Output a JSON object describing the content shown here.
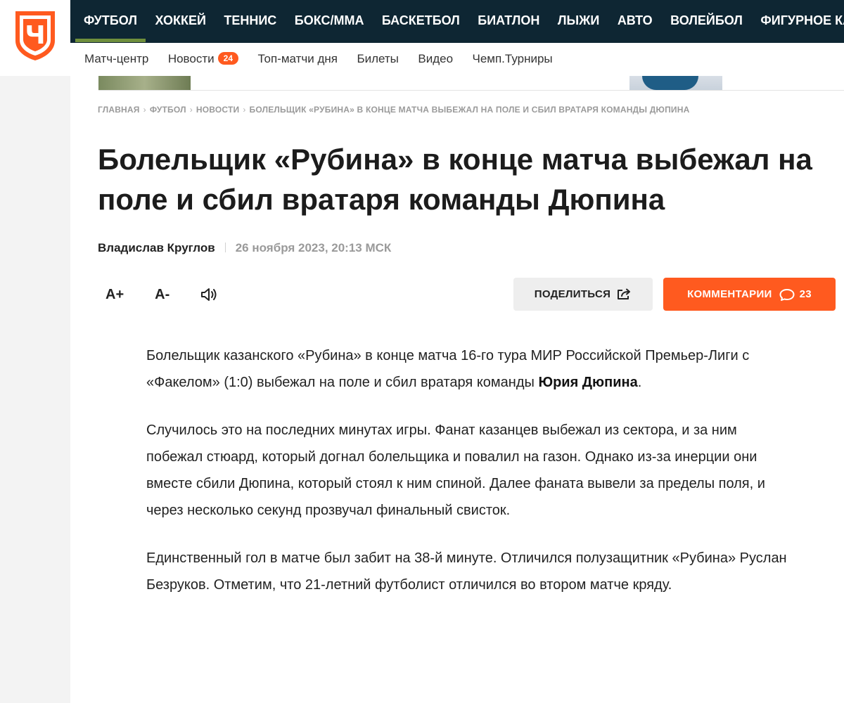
{
  "logo": {
    "letter": "Ч",
    "color": "#ff5a1f"
  },
  "topnav": {
    "items": [
      "ФУТБОЛ",
      "ХОККЕЙ",
      "ТЕННИС",
      "БОКС/ММА",
      "БАСКЕТБОЛ",
      "БИАТЛОН",
      "ЛЫЖИ",
      "АВТО",
      "ВОЛЕЙБОЛ",
      "ФИГУРНОЕ КАТАНИЕ"
    ],
    "active_index": 0,
    "bg_color": "#0e2633",
    "active_underline_color": "#6f8f3c"
  },
  "subnav": {
    "items": [
      {
        "label": "Матч-центр"
      },
      {
        "label": "Новости",
        "badge": "24"
      },
      {
        "label": "Топ-матчи дня"
      },
      {
        "label": "Билеты"
      },
      {
        "label": "Видео"
      },
      {
        "label": "Чемп.Турниры"
      }
    ]
  },
  "breadcrumb": [
    "ГЛАВНАЯ",
    "ФУТБОЛ",
    "НОВОСТИ",
    "БОЛЕЛЬЩИК «РУБИНА» В КОНЦЕ МАТЧА ВЫБЕЖАЛ НА ПОЛЕ И СБИЛ ВРАТАРЯ КОМАНДЫ ДЮПИНА"
  ],
  "article": {
    "title": "Болельщик «Рубина» в конце матча выбежал на поле и сбил вратаря команды Дюпина",
    "author": "Владислав Круглов",
    "date": "26 ноября 2023, 20:13 МСК",
    "p1_text": "Болельщик казанского «Рубина» в конце матча 16-го тура МИР Российской Премьер-Лиги с «Факелом» (1:0) выбежал на поле и сбил вратаря команды ",
    "p1_bold": "Юрия Дюпина",
    "p1_end": ".",
    "p2": "Случилось это на последних минутах игры. Фанат казанцев выбежал из сектора, и за ним побежал стюард, который догнал болельщика и повалил на газон. Однако из-за инерции они вместе сбили Дюпина, который стоял к ним спиной. Далее фаната вывели за пределы поля, и через несколько секунд прозвучал финальный свисток.",
    "p3": "Единственный гол в матче был забит на 38-й минуте. Отличился полузащитник «Рубина» Руслан Безруков. Отметим, что 21-летний футболист отличился во втором матче кряду."
  },
  "tools": {
    "font_increase": "A+",
    "font_decrease": "A-",
    "sound_icon": "speaker-icon"
  },
  "share": {
    "label": "ПОДЕЛИТЬСЯ",
    "icon": "share-icon"
  },
  "comments": {
    "label": "КОММЕНТАРИИ",
    "count": "23",
    "icon": "comment-bubble-icon",
    "color": "#ff5a1f"
  }
}
